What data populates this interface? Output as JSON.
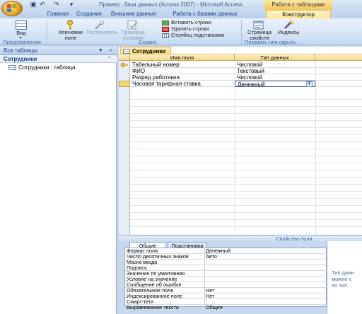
{
  "window": {
    "title": "Пример : база данных (Access 2007) - Microsoft Access",
    "contextual_tools": "Работа с таблицами"
  },
  "ribbon_tabs": [
    "Главная",
    "Создание",
    "Внешние данные",
    "Работа с базами данных",
    "Конструктор"
  ],
  "active_tab": "Конструктор",
  "ribbon": {
    "view": "Вид",
    "key_field": "Ключевое поле",
    "builder": "Построитель",
    "test_conditions": "Проверка условий",
    "insert_rows": "Вставить строки",
    "delete_rows": "Удалить строки",
    "lookup_column": "Столбец подстановок",
    "property_sheet": "Страница свойств",
    "indexes": "Индексы",
    "group_views": "Представления",
    "group_tools": "Сервис",
    "group_show_hide": "Показать или скрыть"
  },
  "nav": {
    "header": "Все таблицы",
    "group": "Сотрудники",
    "item": "Сотрудники : таблица"
  },
  "document": {
    "tab": "Сотрудники",
    "columns": [
      "Имя поля",
      "Тип данных"
    ],
    "rows": [
      {
        "name": "Табельный номер",
        "type": "Числовой",
        "key": true
      },
      {
        "name": "ФИО",
        "type": "Текстовый",
        "key": false
      },
      {
        "name": "Разряд работника",
        "type": "Числовой",
        "key": false
      },
      {
        "name": "Часовая тарифная ставка",
        "type": "Денежный",
        "key": false
      }
    ]
  },
  "properties": {
    "title": "Свойства поля",
    "tabs": [
      "Общие",
      "Подстановка"
    ],
    "rows": [
      {
        "k": "Формат поля",
        "v": "Денежный"
      },
      {
        "k": "Число десятичных знаков",
        "v": "Авто"
      },
      {
        "k": "Маска ввода",
        "v": ""
      },
      {
        "k": "Подпись",
        "v": ""
      },
      {
        "k": "Значение по умолчанию",
        "v": ""
      },
      {
        "k": "Условие на значение",
        "v": ""
      },
      {
        "k": "Сообщение об ошибке",
        "v": ""
      },
      {
        "k": "Обязательное поле",
        "v": "Нет"
      },
      {
        "k": "Индексированное поле",
        "v": "Нет"
      },
      {
        "k": "Смарт-теги",
        "v": ""
      },
      {
        "k": "Выравнивание текста",
        "v": "Общее"
      }
    ],
    "help": "Тип данн\nможно с\nпо тип"
  }
}
